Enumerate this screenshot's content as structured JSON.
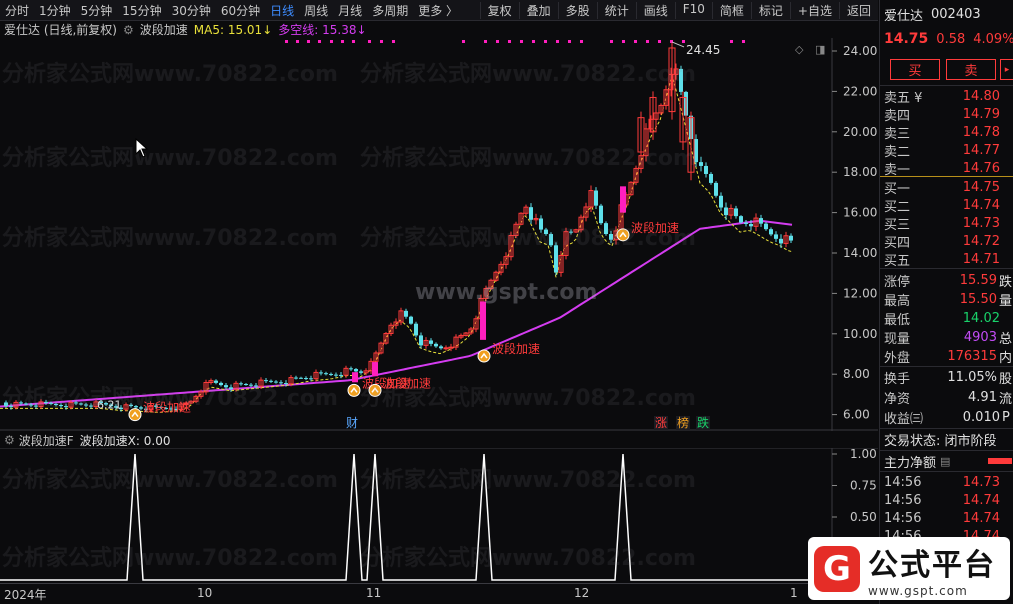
{
  "toolbar": {
    "periods": [
      "分时",
      "1分钟",
      "5分钟",
      "15分钟",
      "30分钟",
      "60分钟",
      "日线",
      "周线",
      "月线",
      "多周期",
      "更多 〉"
    ],
    "active": "日线",
    "tools": [
      "复权",
      "叠加",
      "多股",
      "统计",
      "画线",
      "F10",
      "简框",
      "标记",
      "+自选",
      "返回"
    ]
  },
  "infoline": {
    "title": "爱仕达 (日线,前复权)",
    "indicator": "波段加速",
    "ma5": "MA5: 15.01",
    "dk": "多空线: 15.38"
  },
  "chart": {
    "price_ticks": [
      "24.00",
      "22.00",
      "20.00",
      "18.00",
      "16.00",
      "14.00",
      "12.00",
      "10.00",
      "8.00",
      "6.00"
    ],
    "high_label": "24.45",
    "low_label": "6.21",
    "signal_label": "波段加速",
    "event_labels": [
      "财",
      "涨",
      "榜",
      "跌"
    ],
    "watermark_center": "www.gspt.com",
    "watermark_row": "分析家公式网www.70822.com"
  },
  "sub": {
    "header_name": "波段加速F",
    "header_value": "波段加速X: 0.00",
    "ticks": [
      "1.00",
      "0.75",
      "0.50",
      "0.25"
    ]
  },
  "xaxis": {
    "labels": [
      "2024年",
      "10",
      "11",
      "12",
      "1"
    ]
  },
  "panel": {
    "name": "爱仕达",
    "code": "002403",
    "price": "14.75",
    "change": "0.58",
    "pct": "4.09%",
    "buy_btn": "买",
    "sell_btn": "卖",
    "asks": [
      {
        "label": "卖五 ¥",
        "value": "14.80"
      },
      {
        "label": "卖四",
        "value": "14.79"
      },
      {
        "label": "卖三",
        "value": "14.78"
      },
      {
        "label": "卖二",
        "value": "14.77"
      },
      {
        "label": "卖一",
        "value": "14.76"
      }
    ],
    "bids": [
      {
        "label": "买一",
        "value": "14.75"
      },
      {
        "label": "买二",
        "value": "14.74"
      },
      {
        "label": "买三",
        "value": "14.73"
      },
      {
        "label": "买四",
        "value": "14.72"
      },
      {
        "label": "买五",
        "value": "14.71"
      }
    ],
    "stats": [
      {
        "label": "涨停",
        "value": "15.59",
        "cls": "red",
        "tail": "跌"
      },
      {
        "label": "最高",
        "value": "15.50",
        "cls": "red",
        "tail": "量"
      },
      {
        "label": "最低",
        "value": "14.02",
        "cls": "green",
        "tail": ""
      },
      {
        "label": "现量",
        "value": "4903",
        "cls": "purple",
        "tail": "总"
      },
      {
        "label": "外盘",
        "value": "176315",
        "cls": "red",
        "tail": "内"
      }
    ],
    "stats2": [
      {
        "label": "换手",
        "value": "11.05%",
        "cls": "white",
        "tail": "股"
      },
      {
        "label": "净资",
        "value": "4.91",
        "cls": "white",
        "tail": "流"
      },
      {
        "label": "收益㈢",
        "value": "0.010",
        "cls": "white",
        "tail": "P"
      }
    ],
    "status": "交易状态: 闭市阶段",
    "flow_label": "主力净额",
    "ticks": [
      {
        "time": "14:56",
        "value": "14.73"
      },
      {
        "time": "14:56",
        "value": "14.74"
      },
      {
        "time": "14:56",
        "value": "14.74"
      },
      {
        "time": "14:56",
        "value": "14.74"
      }
    ]
  },
  "logo": {
    "text": "公式平台",
    "url": "www.gspt.com"
  },
  "colors": {
    "up": "#ff3b3b",
    "down": "#5ee0ea",
    "ma_purple": "#d43cf0",
    "dash_yellow": "#e8e03a",
    "signal": "#ff3b3b",
    "magenta": "#ff1fbe"
  }
}
